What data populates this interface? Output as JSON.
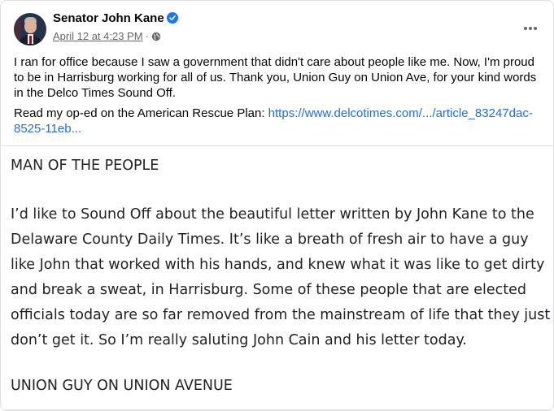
{
  "post": {
    "author": "Senator John Kane",
    "date": "April 12 at 4:23 PM",
    "separator": "·",
    "caption_paragraph": "I ran for office because I saw a government that didn't care about people like me. Now, I'm proud to be in Harrisburg working for all of us. Thank you, Union Guy on Union Ave, for your kind words in the Delco Times Sound Off.",
    "oped_prefix": "Read my op-ed on the American Rescue Plan: ",
    "oped_link": "https://www.delcotimes.com/.../article_83247dac-8525-11eb..."
  },
  "article": {
    "headline": "MAN OF THE PEOPLE",
    "body": "I’d like to Sound Off about the beautiful letter written by John Kane to the Delaware County Daily Times. It’s like a breath of fresh air to have a guy like John that worked with his hands, and knew what it was like to get dirty and break a sweat, in Harrisburg. Some of these people that are elected officials today are so far removed from the mainstream of life that they just don’t get it. So I’m really saluting John Cain and his letter today.",
    "signature": "UNION GUY ON UNION AVENUE"
  },
  "icons": {
    "verified": "verified-badge-icon",
    "audience": "globe-icon",
    "menu": "more-options-icon"
  },
  "colors": {
    "verified": "#1877f2",
    "link": "#216fdb",
    "meta": "#65676b"
  }
}
